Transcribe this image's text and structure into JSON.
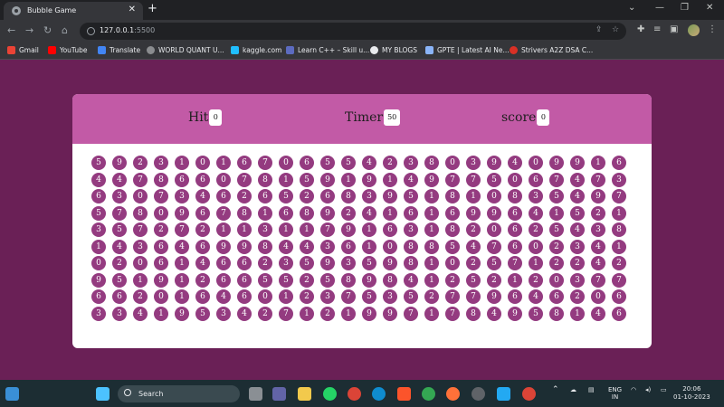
{
  "browser": {
    "tab_title": "Bubble Game",
    "url_host": "127.0.0.1",
    "url_port": ":5500",
    "bookmarks": [
      "Gmail",
      "YouTube",
      "Translate",
      "WORLD QUANT U...",
      "kaggle.com",
      "Learn C++ – Skill u...",
      "MY BLOGS",
      "GPTE | Latest AI Ne...",
      "Strivers A2Z DSA C..."
    ]
  },
  "game": {
    "hit_label": "Hit",
    "hit_value": "0",
    "timer_label": "Timer",
    "timer_value": "50",
    "score_label": "score",
    "score_value": "0",
    "bubble_rows": [
      "59231016706554238039409916080",
      "44786607815919149775067473275",
      "63073462652683951810835497056",
      "57809678168924161699641521008",
      "35727211311791631820625438788",
      "14364699844361088547602341023",
      "02061466235935981025712242222",
      "95191266552589841252120377481",
      "66201646012375352779646206575",
      "33419534271219971784958146535"
    ]
  },
  "taskbar": {
    "search_label": "Search",
    "lang_top": "ENG",
    "lang_bottom": "IN",
    "time": "20:06",
    "date": "01-10-2023"
  },
  "colors": {
    "page_bg": "#6a2056",
    "panel_top": "#c25aa6",
    "bubble": "#943b80"
  }
}
